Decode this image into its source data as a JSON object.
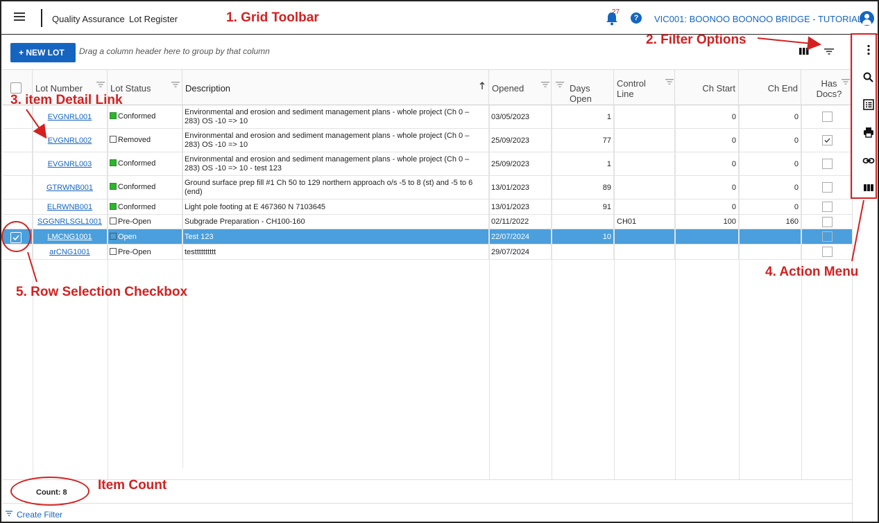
{
  "header": {
    "app_title": "Quality Assurance",
    "page_title": "Lot Register",
    "notification_count": "27",
    "help_label": "?",
    "project_label": "VIC001: BOONOO BOONOO BRIDGE - TUTORIAL"
  },
  "toolbar": {
    "new_lot_label": "+ NEW LOT",
    "group_hint": "Drag a column header here to group by that column"
  },
  "columns": {
    "lot_number": "Lot Number",
    "lot_status": "Lot Status",
    "description": "Description",
    "opened": "Opened",
    "days_open": "Days Open",
    "control_line": "Control Line",
    "ch_start": "Ch Start",
    "ch_end": "Ch End",
    "has_docs": "Has Docs?"
  },
  "rows": [
    {
      "lot": "EVGNRL001",
      "status": "Conformed",
      "status_color": "green",
      "desc": "Environmental and erosion and sediment management plans - whole project (Ch 0 – 283) OS -10 => 10",
      "opened": "03/05/2023",
      "days": "1",
      "control": "",
      "ch_start": "0",
      "ch_end": "0",
      "docs": false,
      "selected": false
    },
    {
      "lot": "EVGNRL002",
      "status": "Removed",
      "status_color": "none",
      "desc": "Environmental and erosion and sediment management plans - whole project (Ch 0 – 283) OS -10 => 10",
      "opened": "25/09/2023",
      "days": "77",
      "control": "",
      "ch_start": "0",
      "ch_end": "0",
      "docs": true,
      "selected": false
    },
    {
      "lot": "EVGNRL003",
      "status": "Conformed",
      "status_color": "green",
      "desc": "Environmental and erosion and sediment management plans - whole project (Ch 0 – 283) OS -10 => 10 - test 123",
      "opened": "25/09/2023",
      "days": "1",
      "control": "",
      "ch_start": "0",
      "ch_end": "0",
      "docs": false,
      "selected": false
    },
    {
      "lot": "GTRWNB001",
      "status": "Conformed",
      "status_color": "green",
      "desc": "Ground surface prep fill #1 Ch 50 to 129 northern approach o/s -5 to 8 (st) and -5 to 6 (end)",
      "opened": "13/01/2023",
      "days": "89",
      "control": "",
      "ch_start": "0",
      "ch_end": "0",
      "docs": false,
      "selected": false
    },
    {
      "lot": "ELRWNB001",
      "status": "Conformed",
      "status_color": "green",
      "desc": "Light pole footing at E 467360 N 7103645",
      "opened": "13/01/2023",
      "days": "91",
      "control": "",
      "ch_start": "0",
      "ch_end": "0",
      "docs": false,
      "selected": false
    },
    {
      "lot": "SGGNRLSGL1001",
      "status": "Pre-Open",
      "status_color": "none",
      "desc": "Subgrade Preparation - CH100-160",
      "opened": "02/11/2022",
      "days": "",
      "control": "CH01",
      "ch_start": "100",
      "ch_end": "160",
      "docs": false,
      "selected": false
    },
    {
      "lot": "LMCNG1001",
      "status": "Open",
      "status_color": "none",
      "desc": "Test 123",
      "opened": "22/07/2024",
      "days": "10",
      "control": "",
      "ch_start": "",
      "ch_end": "",
      "docs": false,
      "selected": true
    },
    {
      "lot": "arCNG1001",
      "status": "Pre-Open",
      "status_color": "none",
      "desc": "testttttttttt",
      "opened": "29/07/2024",
      "days": "",
      "control": "",
      "ch_start": "",
      "ch_end": "",
      "docs": false,
      "selected": false
    }
  ],
  "footer": {
    "count_label": "Count: 8",
    "create_filter_label": "Create Filter"
  },
  "action_menu": [
    "more-options",
    "search",
    "list-details",
    "print",
    "link",
    "columns"
  ],
  "annotations": {
    "grid_toolbar": "1. Grid Toolbar",
    "filter_options": "2. Filter Options",
    "item_detail_link": "3. item Detail Link",
    "action_menu": "4. Action Menu",
    "row_selection": "5. Row Selection Checkbox",
    "item_count": "Item Count"
  },
  "colors": {
    "accent": "#1565c0",
    "selected_row": "#4a9fdc",
    "annotation": "#d42020",
    "status_green": "#2db52d"
  }
}
